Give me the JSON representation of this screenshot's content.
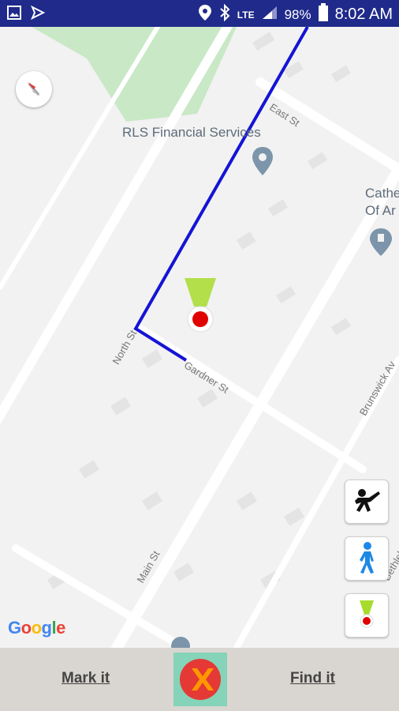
{
  "status_bar": {
    "battery_percent": "98%",
    "time": "8:02 AM",
    "network_badge": "LTE",
    "left_icons": [
      "image-icon",
      "send-icon"
    ],
    "right_icons": [
      "location-icon",
      "bluetooth-icon",
      "signal-icon",
      "battery-icon"
    ]
  },
  "map": {
    "places": [
      {
        "name": "RLS Financial Services"
      },
      {
        "name": "Cathe Of Ar"
      }
    ],
    "streets": [
      "East St",
      "North St",
      "Gardner St",
      "Main St",
      "Brunswick Av",
      "Bethlehe"
    ],
    "attribution": "Google",
    "route_color": "#1414D6"
  },
  "side_buttons": [
    "pointing-person-icon",
    "walking-person-icon",
    "marker-beam-icon"
  ],
  "bottom_bar": {
    "mark_label": "Mark it",
    "find_label": "Find it",
    "center_icon": "close-x-icon"
  }
}
